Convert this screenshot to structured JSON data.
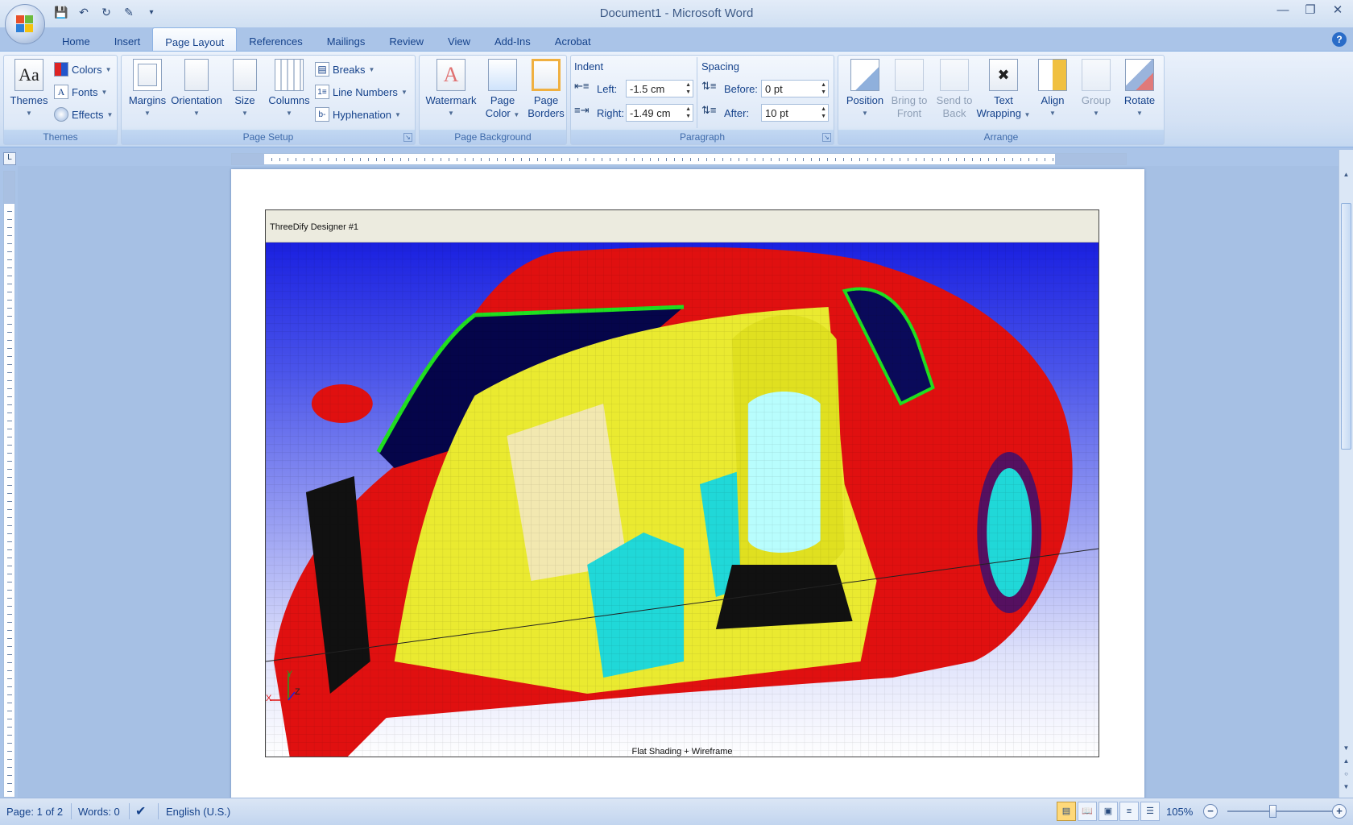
{
  "window": {
    "title": "Document1 - Microsoft Word"
  },
  "tabs": [
    "Home",
    "Insert",
    "Page Layout",
    "References",
    "Mailings",
    "Review",
    "View",
    "Add-Ins",
    "Acrobat"
  ],
  "active_tab": "Page Layout",
  "ribbon": {
    "themes": {
      "themes_label": "Themes",
      "colors_label": "Colors",
      "fonts_label": "Fonts",
      "effects_label": "Effects",
      "group_label": "Themes"
    },
    "page_setup": {
      "margins_label": "Margins",
      "orientation_label": "Orientation",
      "size_label": "Size",
      "columns_label": "Columns",
      "breaks_label": "Breaks",
      "line_numbers_label": "Line Numbers",
      "hyphenation_label": "Hyphenation",
      "group_label": "Page Setup"
    },
    "page_background": {
      "watermark_label": "Watermark",
      "page_color_line1": "Page",
      "page_color_line2": "Color",
      "page_borders_line1": "Page",
      "page_borders_line2": "Borders",
      "group_label": "Page Background"
    },
    "paragraph": {
      "indent_title": "Indent",
      "left_label": "Left:",
      "left_value": "-1.5 cm",
      "right_label": "Right:",
      "right_value": "-1.49 cm",
      "spacing_title": "Spacing",
      "before_label": "Before:",
      "before_value": "0 pt",
      "after_label": "After:",
      "after_value": "10 pt",
      "group_label": "Paragraph"
    },
    "arrange": {
      "position_label": "Position",
      "bring_front_line1": "Bring to",
      "bring_front_line2": "Front",
      "send_back_line1": "Send to",
      "send_back_line2": "Back",
      "text_wrapping_line1": "Text",
      "text_wrapping_line2": "Wrapping",
      "align_label": "Align",
      "group_btn_label": "Group",
      "rotate_label": "Rotate",
      "group_label": "Arrange"
    }
  },
  "embedded": {
    "app_title": "ThreeDify Designer #1",
    "caption": "Flat Shading + Wireframe",
    "axis_y": "Y",
    "axis_z": "Z",
    "axis_x": "X"
  },
  "status": {
    "page": "Page: 1 of 2",
    "words": "Words: 0",
    "language": "English (U.S.)",
    "zoom": "105%"
  },
  "icons": [
    "office-button-icon",
    "save-icon",
    "undo-icon",
    "redo-icon",
    "customize-icon",
    "help-icon",
    "proofing-icon"
  ],
  "colors": {
    "viewport_top": "#1a20e0",
    "car_red": "#e01010",
    "wire_green": "#20e020",
    "seat_yellow": "#eaea30",
    "console_cyan": "#20d8d8"
  }
}
